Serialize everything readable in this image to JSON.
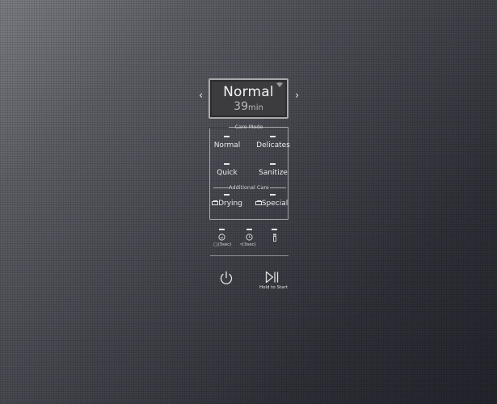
{
  "display": {
    "mode": "Normal",
    "time_value": "39",
    "time_unit": "min",
    "wifi_icon": "wifi-icon",
    "prev_icon": "chevron-left-icon",
    "next_icon": "chevron-right-icon",
    "prev_glyph": "‹",
    "next_glyph": "›"
  },
  "care_mode": {
    "title": "Care Mode",
    "options": [
      {
        "label": "Normal"
      },
      {
        "label": "Delicates"
      },
      {
        "label": "Quick"
      },
      {
        "label": "Sanitize"
      }
    ]
  },
  "additional_care": {
    "title": "Additional Care",
    "options": [
      {
        "label": "Drying",
        "icon": "dryer-icon"
      },
      {
        "label": "Special",
        "icon": "dryer-icon"
      }
    ]
  },
  "functions": [
    {
      "icon": "smart-control-icon",
      "label": "(3sec)",
      "label_icon": "lock-icon"
    },
    {
      "icon": "timer-icon",
      "label": "(3sec)",
      "label_icon": "wifi-remote-icon"
    },
    {
      "icon": "light-icon",
      "label": ""
    }
  ],
  "controls": {
    "power_icon": "power-icon",
    "start_icon": "play-pause-icon",
    "start_label": "Hold to Start"
  },
  "colors": {
    "background_light": "#7c7e84",
    "background_dark": "#23242c",
    "border": "#a6a6a8",
    "text": "#ececec"
  }
}
